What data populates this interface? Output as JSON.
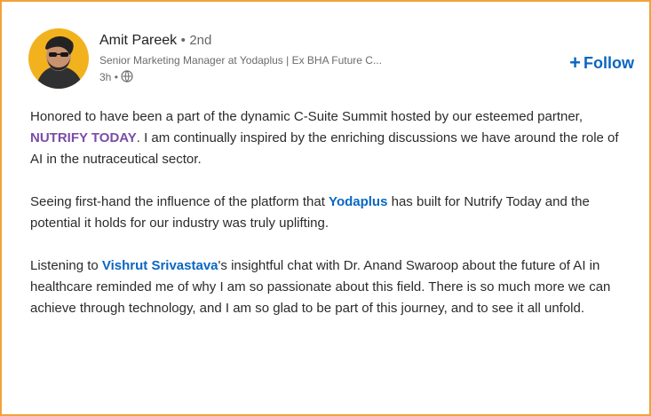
{
  "post": {
    "author": {
      "name": "Amit Pareek",
      "connection_separator": "•",
      "connection_degree": "2nd",
      "headline": "Senior Marketing Manager at Yodaplus | Ex BHA Future C...",
      "time": "3h",
      "visibility_separator": "•",
      "visibility_icon": "globe-icon"
    },
    "follow": {
      "icon": "plus-icon",
      "icon_glyph": "+",
      "label": "Follow"
    },
    "paragraph_1": {
      "before": "Honored to have been a part of the dynamic C-Suite Summit hosted by our esteemed partner, ",
      "mention": "NUTRIFY TODAY",
      "after": ". I am continually inspired by the enriching discussions we have around the role of AI in the nutraceutical sector."
    },
    "paragraph_2": {
      "before": "Seeing first-hand the influence of the platform that ",
      "mention": "Yodaplus",
      "after": " has built for Nutrify Today and the potential it holds for our industry was truly uplifting."
    },
    "paragraph_3": {
      "before": "Listening to ",
      "mention": "Vishrut Srivastava",
      "after": "'s insightful chat with Dr. Anand Swaroop about the future of AI in healthcare reminded me of why I am so passionate about this field. There is so much more we can achieve through technology, and I am so glad to be part of this journey, and to see it all unfold."
    }
  },
  "colors": {
    "frame_border": "#f1a23a",
    "link_blue": "#0a66c2",
    "mention_purple": "#7b4ca8",
    "text": "#2b2b2b",
    "muted": "#6b6b6b",
    "avatar_bg": "#f2b21e"
  }
}
